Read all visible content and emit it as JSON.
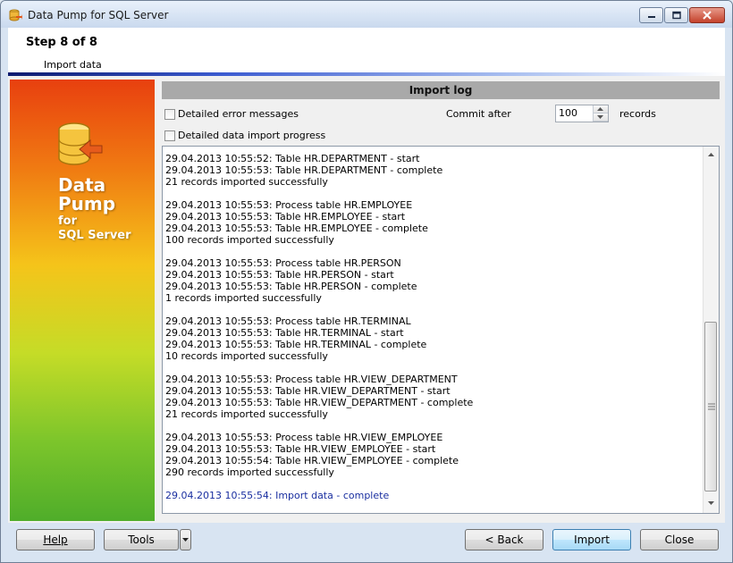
{
  "window": {
    "title": "Data Pump for SQL Server"
  },
  "header": {
    "step": "Step 8 of 8",
    "subtitle": "Import data"
  },
  "side_panel": {
    "brand_line1": "Data",
    "brand_line2": "Pump",
    "brand_line3": "for",
    "brand_line4": "SQL Server"
  },
  "import_log": {
    "title": "Import log",
    "detailed_errors_label": "Detailed error messages",
    "detailed_errors_checked": false,
    "detailed_progress_label": "Detailed data import progress",
    "detailed_progress_checked": false,
    "commit_label": "Commit after",
    "commit_value": "100",
    "records_label": "records"
  },
  "log_lines": [
    "29.04.2013 10:55:52: Table HR.DEPARTMENT - start",
    "29.04.2013 10:55:53: Table HR.DEPARTMENT - complete",
    "21 records imported successfully",
    "",
    "29.04.2013 10:55:53: Process table HR.EMPLOYEE",
    "29.04.2013 10:55:53: Table HR.EMPLOYEE - start",
    "29.04.2013 10:55:53: Table HR.EMPLOYEE - complete",
    "100 records imported successfully",
    "",
    "29.04.2013 10:55:53: Process table HR.PERSON",
    "29.04.2013 10:55:53: Table HR.PERSON - start",
    "29.04.2013 10:55:53: Table HR.PERSON - complete",
    "1 records imported successfully",
    "",
    "29.04.2013 10:55:53: Process table HR.TERMINAL",
    "29.04.2013 10:55:53: Table HR.TERMINAL - start",
    "29.04.2013 10:55:53: Table HR.TERMINAL - complete",
    "10 records imported successfully",
    "",
    "29.04.2013 10:55:53: Process table HR.VIEW_DEPARTMENT",
    "29.04.2013 10:55:53: Table HR.VIEW_DEPARTMENT - start",
    "29.04.2013 10:55:53: Table HR.VIEW_DEPARTMENT - complete",
    "21 records imported successfully",
    "",
    "29.04.2013 10:55:53: Process table HR.VIEW_EMPLOYEE",
    "29.04.2013 10:55:53: Table HR.VIEW_EMPLOYEE - start",
    "29.04.2013 10:55:54: Table HR.VIEW_EMPLOYEE - complete",
    "290 records imported successfully",
    "",
    "29.04.2013 10:55:54: Import data - complete"
  ],
  "log_highlight_color": "#1a2fa0",
  "footer": {
    "help_label": "Help",
    "tools_label": "Tools",
    "back_label": "< Back",
    "import_label": "Import",
    "close_label": "Close"
  },
  "icons": [
    "app-icon",
    "minimize-icon",
    "maximize-icon",
    "close-icon",
    "database-logo-icon",
    "spin-up-icon",
    "spin-down-icon",
    "scroll-up-icon",
    "scroll-down-icon",
    "dropdown-arrow-icon"
  ]
}
